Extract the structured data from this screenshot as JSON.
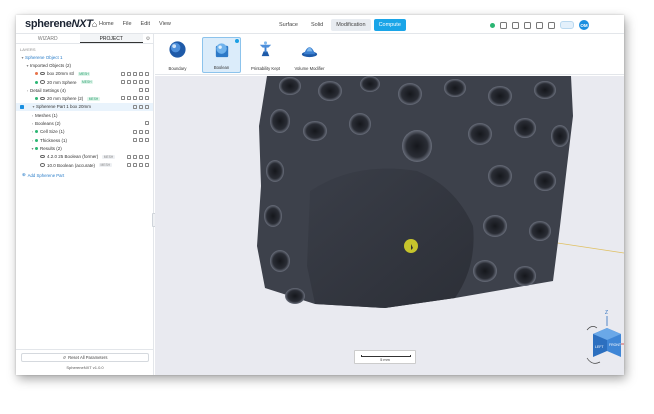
{
  "app": {
    "logo_main": "spherene",
    "logo_accent": "NXT"
  },
  "menu": [
    {
      "label": "Home",
      "icon": "home-icon"
    },
    {
      "label": "File"
    },
    {
      "label": "Edit"
    },
    {
      "label": "View"
    }
  ],
  "mode_tabs": [
    {
      "label": "Surface",
      "active": false
    },
    {
      "label": "Solid",
      "active": false
    },
    {
      "label": "Modification",
      "active": true
    },
    {
      "label": "Compute",
      "active": false,
      "primary": true
    }
  ],
  "user": {
    "initials": "OM"
  },
  "sidebar": {
    "tabs": [
      {
        "label": "WIZARD",
        "active": false
      },
      {
        "label": "PROJECT",
        "active": true
      }
    ],
    "layers_label": "LAYERS",
    "items": [
      {
        "label": "Spherene Object 1",
        "level": 0,
        "style": "blue",
        "chev": "▾"
      },
      {
        "label": "Imported Objects (2)",
        "level": 1,
        "chev": "▾"
      },
      {
        "label": "box 20mm stl",
        "level": 2,
        "badge": "MESH",
        "dot": "#e8734a",
        "actions": 5
      },
      {
        "label": "20 mm Sphere",
        "level": 2,
        "badge": "MESH",
        "dot": "#2bb673",
        "actions": 5
      },
      {
        "label": "Detail Settings (4)",
        "level": 1,
        "chev": "›",
        "actions": 2
      },
      {
        "label": "20 mm Sphere (2)",
        "level": 2,
        "badge": "MESH",
        "dot": "#2bb673",
        "actions": 5
      },
      {
        "label": "Spherene Part 1 box 20mm",
        "level": 1,
        "chev": "▾",
        "selected": true,
        "actions": 3
      },
      {
        "label": "Meshes (1)",
        "level": 2,
        "chev": "›"
      },
      {
        "label": "Booleans (2)",
        "level": 2,
        "chev": "›",
        "actions": 1
      },
      {
        "label": "Cell Size (1)",
        "level": 2,
        "chev": "›",
        "dot": "#2bb673",
        "actions": 3
      },
      {
        "label": "Thickness (1)",
        "level": 2,
        "chev": "›",
        "dot": "#2bb673",
        "actions": 3
      },
      {
        "label": "Results (2)",
        "level": 2,
        "chev": "▾",
        "dot": "#2bb673"
      },
      {
        "label": "4.2.0 25 Boolean (former)",
        "level": 3,
        "badge2": "MESH",
        "actions": 4
      },
      {
        "label": "10.0 Boolean (accurate)",
        "level": 3,
        "badge2": "MESH",
        "actions": 4
      }
    ],
    "add_part": "Add Spherene Part",
    "reset_label": "Reset All Parameters",
    "version": "SphereneNXT v1.0.0"
  },
  "toolbar": [
    {
      "label": "Boundary",
      "icon": "boundary-icon",
      "active": false
    },
    {
      "label": "Boolean",
      "icon": "boolean-icon",
      "active": true
    },
    {
      "label": "Printability Kept",
      "icon": "printability-icon",
      "active": false
    },
    {
      "label": "Volume Modifier",
      "icon": "volume-modifier-icon",
      "active": false
    }
  ],
  "viewport": {
    "scale_label": "5 mm",
    "viewcube": {
      "front_label": "FRONT",
      "left_label": "LEFT",
      "axis_z": "Z",
      "axis_x": "X"
    }
  },
  "colors": {
    "accent": "#1aa5e8",
    "mesh_badge": "#2aa070",
    "model": "#3d414b",
    "viewport_bg": "#e9eaf0",
    "cursor": "#d6d42a"
  }
}
